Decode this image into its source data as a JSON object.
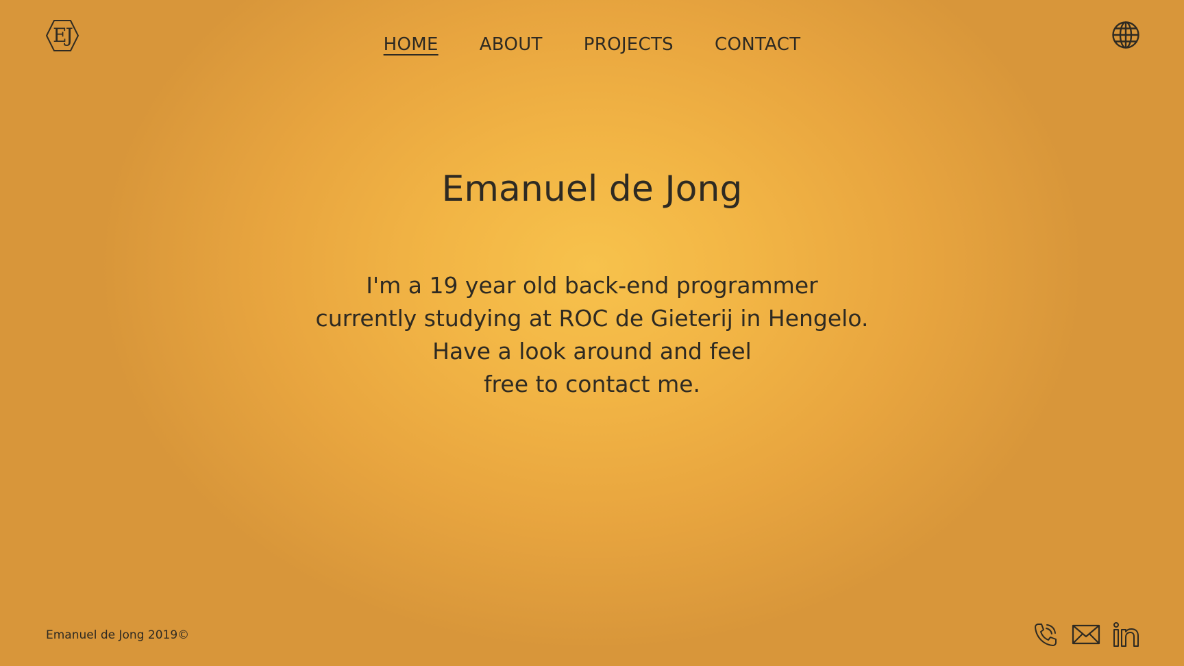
{
  "header": {
    "logo_text": "EJ",
    "logo_icon": "hexagon-monogram-logo",
    "language_icon": "globe-icon"
  },
  "nav": {
    "items": [
      {
        "label": "HOME",
        "active": true
      },
      {
        "label": "ABOUT",
        "active": false
      },
      {
        "label": "PROJECTS",
        "active": false
      },
      {
        "label": "CONTACT",
        "active": false
      }
    ]
  },
  "hero": {
    "title": "Emanuel de Jong",
    "lines": [
      "I'm a 19 year old back-end programmer",
      "currently studying at ROC de Gieterij in Hengelo.",
      "Have a look around and feel",
      "free to contact me."
    ]
  },
  "footer": {
    "copyright": "Emanuel de Jong 2019©",
    "social_icons": [
      "phone-icon",
      "mail-icon",
      "linkedin-icon"
    ]
  },
  "colors": {
    "background_center": "#f7c24c",
    "background_edge": "#d8963a",
    "text": "#2e2a22"
  }
}
